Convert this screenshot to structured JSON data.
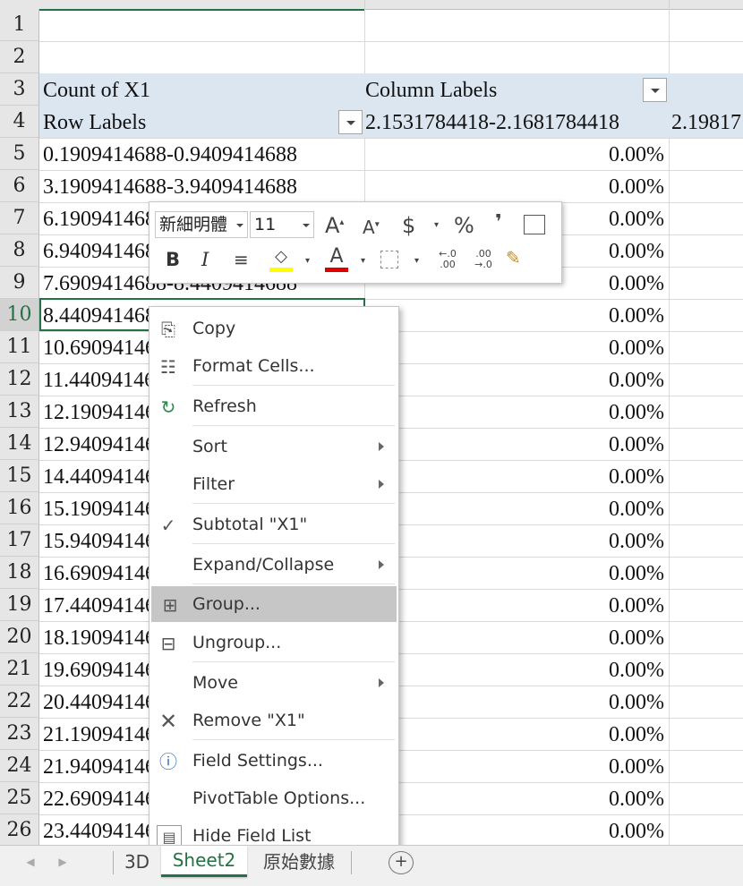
{
  "rows": [
    {
      "num": "1",
      "a": "",
      "c": ""
    },
    {
      "num": "2",
      "a": "",
      "c": ""
    },
    {
      "num": "3",
      "a": "Count of X1",
      "b": "Column Labels",
      "c": ""
    },
    {
      "num": "4",
      "a": "Row Labels",
      "b": "2.1531784418-2.1681784418",
      "c": "2.19817"
    },
    {
      "num": "5",
      "a": "0.1909414688-0.9409414688",
      "pct": "0.00%"
    },
    {
      "num": "6",
      "a": "3.1909414688-3.9409414688",
      "pct": "0.00%"
    },
    {
      "num": "7",
      "a": "6.190941468",
      "pct": "0.00%"
    },
    {
      "num": "8",
      "a": "6.940941468",
      "pct": "0.00%"
    },
    {
      "num": "9",
      "a": "7.6909414688-8.4409414688",
      "pct": "0.00%"
    },
    {
      "num": "10",
      "a": "8.440941468",
      "pct": "0.00%"
    },
    {
      "num": "11",
      "a": "10.69094146",
      "pct": "0.00%"
    },
    {
      "num": "12",
      "a": "11.44094146",
      "pct": "0.00%"
    },
    {
      "num": "13",
      "a": "12.19094146",
      "pct": "0.00%"
    },
    {
      "num": "14",
      "a": "12.94094146",
      "pct": "0.00%"
    },
    {
      "num": "15",
      "a": "14.44094146",
      "pct": "0.00%"
    },
    {
      "num": "16",
      "a": "15.19094146",
      "pct": "0.00%"
    },
    {
      "num": "17",
      "a": "15.94094146",
      "pct": "0.00%"
    },
    {
      "num": "18",
      "a": "16.69094146",
      "pct": "0.00%"
    },
    {
      "num": "19",
      "a": "17.44094146",
      "pct": "0.00%"
    },
    {
      "num": "20",
      "a": "18.19094146",
      "pct": "0.00%"
    },
    {
      "num": "21",
      "a": "19.69094146",
      "pct": "0.00%"
    },
    {
      "num": "22",
      "a": "20.44094146",
      "pct": "0.00%"
    },
    {
      "num": "23",
      "a": "21.19094146",
      "pct": "0.00%"
    },
    {
      "num": "24",
      "a": "21.94094146",
      "pct": "0.00%"
    },
    {
      "num": "25",
      "a": "22.69094146",
      "pct": "0.00%"
    },
    {
      "num": "26",
      "a": "23.44094146",
      "pct": "0.00%"
    }
  ],
  "toolbar": {
    "font_name": "新細明體",
    "font_size": "11",
    "increase_font": "A",
    "decrease_font": "A",
    "currency": "$",
    "percent": "%",
    "comma": "❜",
    "bold": "B",
    "italic": "I",
    "font_color_letter": "A",
    "decimal_increase": "←.0 .00",
    "decimal_decrease": ".00 →.0",
    "fill_color": "#ffff00",
    "font_color": "#e00000"
  },
  "menu": {
    "copy": "Copy",
    "format_cells": "Format Cells...",
    "refresh": "Refresh",
    "sort": "Sort",
    "filter": "Filter",
    "subtotal": "Subtotal \"X1\"",
    "expand_collapse": "Expand/Collapse",
    "group": "Group...",
    "ungroup": "Ungroup...",
    "move": "Move",
    "remove": "Remove \"X1\"",
    "field_settings": "Field Settings...",
    "pivot_options": "PivotTable Options...",
    "hide_field_list": "Hide Field List"
  },
  "tabs": {
    "t1": "3D",
    "t2": "Sheet2",
    "t3": "原始數據",
    "add": "+"
  },
  "colors": {
    "accent": "#217346",
    "pivot_header": "#dce6f1",
    "highlight": "#c6c6c6"
  }
}
